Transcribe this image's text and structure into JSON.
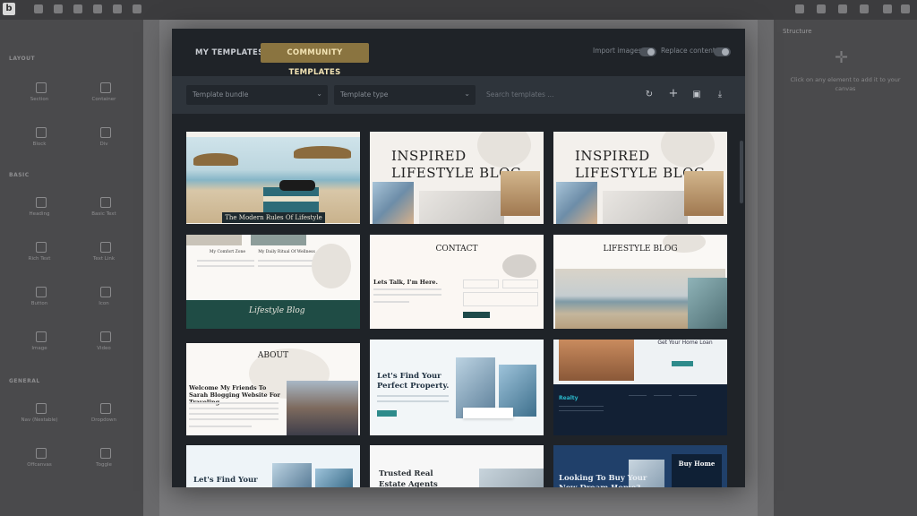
{
  "app": {
    "logo_letter": "b"
  },
  "left_panel": {
    "sections": [
      {
        "title": "LAYOUT",
        "items": [
          "Section",
          "Container",
          "Block",
          "Div"
        ]
      },
      {
        "title": "BASIC",
        "items": [
          "Heading",
          "Basic Text",
          "Rich Text",
          "Text Link",
          "Button",
          "Icon",
          "Image",
          "Video"
        ]
      },
      {
        "title": "GENERAL",
        "items": [
          "Nav (Nestable)",
          "Dropdown",
          "Offcanvas",
          "Toggle"
        ]
      }
    ]
  },
  "right_panel": {
    "title": "Structure",
    "hint": "Click on any element to add it to your canvas"
  },
  "modal": {
    "tabs": {
      "my": "MY TEMPLATES",
      "community": "COMMUNITY TEMPLATES"
    },
    "toggles": {
      "import_images": "Import images",
      "replace_content": "Replace content"
    },
    "filters": {
      "bundle_placeholder": "Template bundle",
      "type_placeholder": "Template type",
      "search_placeholder": "Search templates ..."
    },
    "action_icons": [
      "refresh-icon",
      "plus-icon",
      "save-icon",
      "download-icon"
    ],
    "cards": [
      {
        "caption": "The Modern Rules Of Lifestyle"
      },
      {
        "title": "INSPIRED LIFESTYLE BLOG"
      },
      {
        "title": "INSPIRED LIFESTYLE BLOG"
      },
      {
        "col1": "My Comfort Zone",
        "col2": "My Daily Ritual Of Wellness",
        "signature": "Lifestyle Blog"
      },
      {
        "title": "CONTACT",
        "heading": "Lets Talk, I'm Here."
      },
      {
        "title": "LIFESTYLE BLOG"
      },
      {
        "title": "ABOUT",
        "heading": "Welcome My Friends To Sarah Blogging Website For Traveling."
      },
      {
        "heading": "Let's Find Your Perfect Property."
      },
      {
        "banner": "Get Your Home Loan",
        "logo": "Realty"
      },
      {
        "heading": "Let's Find Your"
      },
      {
        "heading": "Trusted Real Estate Agents"
      },
      {
        "heading": "Looking To Buy Your New Dream Home?",
        "cta": "Buy Home"
      }
    ]
  },
  "colors": {
    "accent": "#8a7440",
    "accent_text": "#f2e3b4",
    "modal_bg": "#1f2328"
  }
}
